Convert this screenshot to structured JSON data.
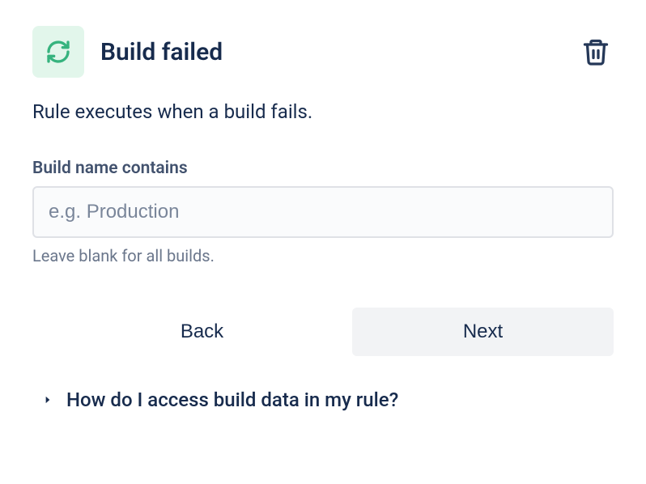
{
  "header": {
    "title": "Build failed"
  },
  "description": "Rule executes when a build fails.",
  "field": {
    "label": "Build name contains",
    "placeholder": "e.g. Production",
    "value": "",
    "helper": "Leave blank for all builds."
  },
  "buttons": {
    "back": "Back",
    "next": "Next"
  },
  "expand": {
    "text": "How do I access build data in my rule?"
  }
}
